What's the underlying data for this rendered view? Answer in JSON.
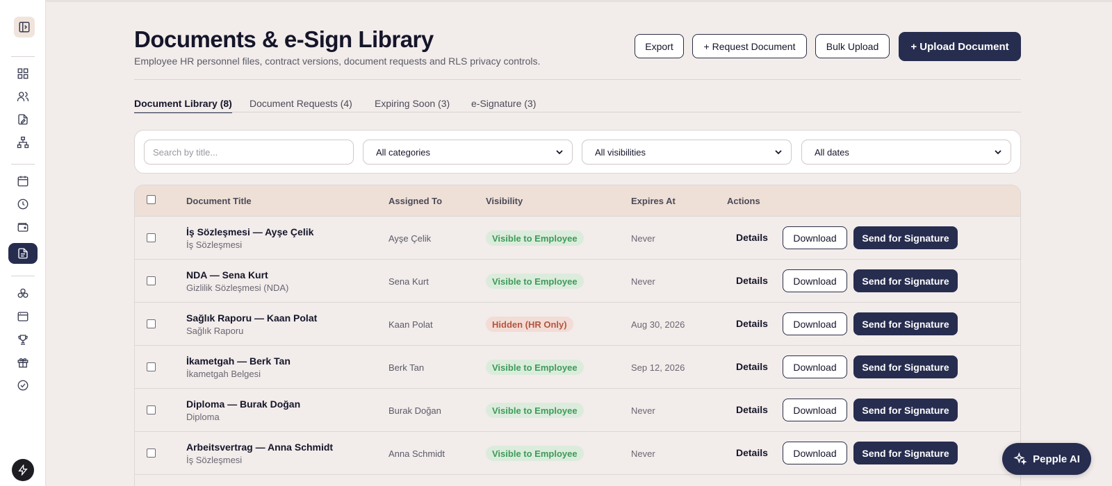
{
  "header": {
    "title": "Documents & e-Sign Library",
    "subtitle": "Employee HR personnel files, contract versions, document requests and RLS privacy controls.",
    "export_label": "Export",
    "request_label": "+ Request Document",
    "bulk_label": "Bulk Upload",
    "upload_label": "+ Upload Document"
  },
  "tabs": [
    {
      "label": "Document Library (8)"
    },
    {
      "label": "Document Requests (4)"
    },
    {
      "label": "Expiring Soon (3)"
    },
    {
      "label": "e-Signature (3)"
    }
  ],
  "filters": {
    "search_placeholder": "Search by title...",
    "category": "All categories",
    "visibility": "All visibilities",
    "dates": "All dates"
  },
  "table": {
    "headers": {
      "title": "Document Title",
      "assigned": "Assigned To",
      "visibility": "Visibility",
      "expires": "Expires At",
      "actions": "Actions"
    },
    "actions": {
      "details": "Details",
      "download": "Download",
      "sign": "Send for Signature"
    },
    "rows": [
      {
        "title": "İş Sözleşmesi — Ayşe Çelik",
        "category": "İş Sözleşmesi",
        "assigned": "Ayşe Çelik",
        "visibility": "Visible to Employee",
        "expires": "Never"
      },
      {
        "title": "NDA — Sena Kurt",
        "category": "Gizlilik Sözleşmesi (NDA)",
        "assigned": "Sena Kurt",
        "visibility": "Visible to Employee",
        "expires": "Never"
      },
      {
        "title": "Sağlık Raporu — Kaan Polat",
        "category": "Sağlık Raporu",
        "assigned": "Kaan Polat",
        "visibility": "Hidden (HR Only)",
        "expires": "Aug 30, 2026"
      },
      {
        "title": "İkametgah — Berk Tan",
        "category": "İkametgah Belgesi",
        "assigned": "Berk Tan",
        "visibility": "Visible to Employee",
        "expires": "Sep 12, 2026"
      },
      {
        "title": "Diploma — Burak Doğan",
        "category": "Diploma",
        "assigned": "Burak Doğan",
        "visibility": "Visible to Employee",
        "expires": "Never"
      },
      {
        "title": "Arbeitsvertrag — Anna Schmidt",
        "category": "İş Sözleşmesi",
        "assigned": "Anna Schmidt",
        "visibility": "Visible to Employee",
        "expires": "Never"
      }
    ]
  },
  "ai": {
    "label": "Pepple AI"
  },
  "colors": {
    "primary": "#272d4f",
    "background": "#f2ecea",
    "badge_green": "#3f9a5a",
    "badge_red": "#b3553f"
  }
}
